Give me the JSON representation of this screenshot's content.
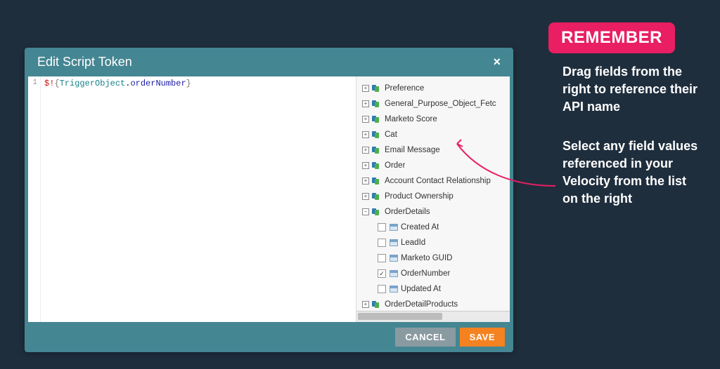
{
  "dialog": {
    "title": "Edit Script Token",
    "close_symbol": "×",
    "cancel_label": "CANCEL",
    "save_label": "SAVE"
  },
  "code": {
    "line_number": "1",
    "dollar": "$!",
    "lbrace": "{",
    "object": "TriggerObject",
    "dot": ".",
    "property": "orderNumber",
    "rbrace": "}"
  },
  "tree": {
    "items": [
      {
        "label": "Preference",
        "type": "object",
        "expand": "+"
      },
      {
        "label": "General_Purpose_Object_Fetc",
        "type": "object",
        "expand": "+"
      },
      {
        "label": "Marketo Score",
        "type": "object",
        "expand": "+"
      },
      {
        "label": "Cat",
        "type": "object",
        "expand": "+"
      },
      {
        "label": "Email Message",
        "type": "object",
        "expand": "+"
      },
      {
        "label": "Order",
        "type": "object",
        "expand": "+"
      },
      {
        "label": "Account Contact Relationship",
        "type": "object",
        "expand": "+"
      },
      {
        "label": "Product Ownership",
        "type": "object",
        "expand": "+"
      },
      {
        "label": "OrderDetails",
        "type": "object",
        "expand": "−"
      },
      {
        "label": "Created At",
        "type": "field",
        "checked": false
      },
      {
        "label": "LeadId",
        "type": "field",
        "checked": false
      },
      {
        "label": "Marketo GUID",
        "type": "field",
        "checked": false
      },
      {
        "label": "OrderNumber",
        "type": "field",
        "checked": true
      },
      {
        "label": "Updated At",
        "type": "field",
        "checked": false
      },
      {
        "label": "OrderDetailProducts",
        "type": "object",
        "expand": "+"
      }
    ]
  },
  "note": {
    "badge": "REMEMBER",
    "p1": "Drag fields from the right to reference their API name",
    "p2": "Select any field values referenced in your Velocity from the list on the right"
  }
}
